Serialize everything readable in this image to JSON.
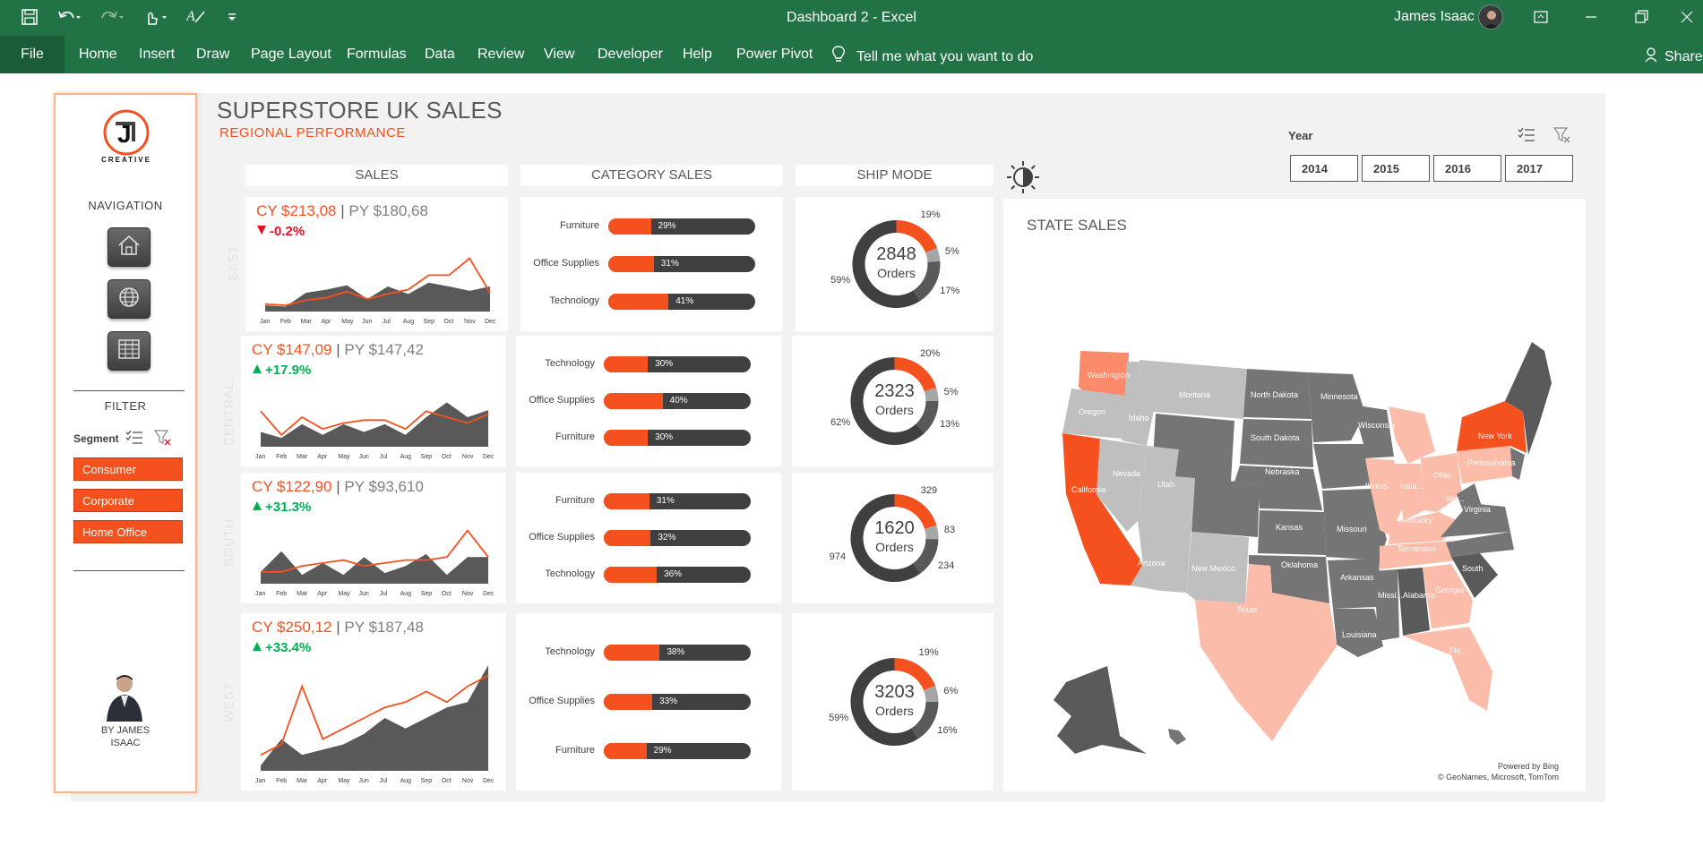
{
  "window": {
    "title": "Dashboard 2  -  Excel",
    "user": "James Isaac"
  },
  "ribbon": {
    "file": "File",
    "tabs": [
      "Home",
      "Insert",
      "Draw",
      "Page Layout",
      "Formulas",
      "Data",
      "Review",
      "View",
      "Developer",
      "Help",
      "Power Pivot"
    ],
    "tell_me": "Tell me what you want to do",
    "share": "Share"
  },
  "sidebar": {
    "logo_letter": "J",
    "logo_text": "CREATIVE",
    "navigation": "NAVIGATION",
    "nav_icons": [
      "home-icon",
      "globe-icon",
      "table-icon"
    ],
    "filter": "FILTER",
    "segment_label": "Segment",
    "segments": [
      "Consumer",
      "Corporate",
      "Home Office"
    ],
    "author": "BY JAMES ISAAC"
  },
  "header": {
    "title": "SUPERSTORE UK SALES",
    "subtitle": "REGIONAL PERFORMANCE"
  },
  "columns": {
    "sales": "SALES",
    "category": "CATEGORY SALES",
    "ship": "SHIP MODE"
  },
  "year_slicer": {
    "label": "Year",
    "years": [
      "2014",
      "2015",
      "2016",
      "2017"
    ]
  },
  "map": {
    "title": "STATE SALES",
    "credit1": "Powered by Bing",
    "credit2": "© GeoNames, Microsoft, TomTom",
    "colors": {
      "high": "#f4511e",
      "mid_high": "#fbbcaa",
      "mid": "#bfbfbf",
      "low": "#757575",
      "lowest": "#5a5a5a"
    }
  },
  "colors": {
    "accent": "#f4511e",
    "dark": "#404040",
    "up": "#00b050",
    "down": "#e81123"
  },
  "chart_data": [
    {
      "type": "area",
      "region": "EAST",
      "cy": "CY $213,08",
      "py": "PY $180,68",
      "delta": "-0.2%",
      "direction": "down",
      "categories": [
        "Jan",
        "Feb",
        "Mar",
        "Apr",
        "May",
        "Jun",
        "Jul",
        "Aug",
        "Sep",
        "Oct",
        "Nov",
        "Dec"
      ],
      "series": [
        {
          "values": [
            10,
            8,
            30,
            35,
            42,
            20,
            40,
            28,
            46,
            40,
            33,
            40
          ]
        },
        {
          "values": [
            12,
            10,
            18,
            22,
            32,
            20,
            28,
            35,
            58,
            58,
            85,
            30
          ]
        }
      ]
    },
    {
      "type": "area",
      "region": "CENTRAL",
      "cy": "CY $147,09",
      "py": "PY $147,42",
      "delta": "+17.9%",
      "direction": "up",
      "categories": [
        "Jan",
        "Feb",
        "Mar",
        "Apr",
        "May",
        "Jun",
        "Jul",
        "Aug",
        "Sep",
        "Oct",
        "Nov",
        "Dec"
      ],
      "series": [
        {
          "values": [
            25,
            15,
            38,
            20,
            38,
            25,
            38,
            20,
            50,
            75,
            50,
            62
          ]
        },
        {
          "values": [
            60,
            20,
            50,
            30,
            40,
            45,
            45,
            30,
            60,
            50,
            40,
            55
          ]
        }
      ]
    },
    {
      "type": "area",
      "region": "SOUTH",
      "cy": "CY $122,90",
      "py": "PY $93,610",
      "delta": "+31.3%",
      "direction": "up",
      "categories": [
        "Jan",
        "Feb",
        "Mar",
        "Apr",
        "May",
        "Jun",
        "Jul",
        "Aug",
        "Sep",
        "Oct",
        "Nov",
        "Dec"
      ],
      "series": [
        {
          "values": [
            20,
            55,
            15,
            35,
            15,
            45,
            18,
            30,
            50,
            15,
            45,
            45
          ]
        },
        {
          "values": [
            20,
            20,
            30,
            35,
            40,
            30,
            35,
            40,
            40,
            45,
            90,
            45
          ]
        }
      ]
    },
    {
      "type": "area",
      "region": "WEST",
      "cy": "CY $250,12",
      "py": "PY $187,48",
      "delta": "+33.4%",
      "direction": "up",
      "categories": [
        "Jan",
        "Feb",
        "Mar",
        "Apr",
        "May",
        "Jun",
        "Jul",
        "Aug",
        "Sep",
        "Oct",
        "Nov",
        "Dec"
      ],
      "series": [
        {
          "values": [
            5,
            30,
            15,
            20,
            25,
            35,
            50,
            40,
            50,
            60,
            65,
            100
          ]
        },
        {
          "values": [
            15,
            25,
            80,
            30,
            40,
            50,
            60,
            65,
            75,
            65,
            80,
            90
          ]
        }
      ]
    },
    {
      "type": "bar",
      "region": "EAST",
      "categories": [
        "Furniture",
        "Office Supplies",
        "Technology"
      ],
      "values": [
        29,
        31,
        41
      ],
      "labels": [
        "29%",
        "31%",
        "41%"
      ]
    },
    {
      "type": "bar",
      "region": "CENTRAL",
      "categories": [
        "Technology",
        "Office Supplies",
        "Furniture"
      ],
      "values": [
        30,
        40,
        30
      ],
      "labels": [
        "30%",
        "40%",
        "30%"
      ]
    },
    {
      "type": "bar",
      "region": "SOUTH",
      "categories": [
        "Furniture",
        "Office Supplies",
        "Technology"
      ],
      "values": [
        31,
        32,
        36
      ],
      "labels": [
        "31%",
        "32%",
        "36%"
      ]
    },
    {
      "type": "bar",
      "region": "WEST",
      "categories": [
        "Technology",
        "Office Supplies",
        "Furniture"
      ],
      "values": [
        38,
        33,
        29
      ],
      "labels": [
        "38%",
        "33%",
        "29%"
      ]
    },
    {
      "type": "pie",
      "region": "EAST",
      "total": "2848",
      "total_label": "Orders",
      "values": [
        19,
        5,
        17,
        59
      ],
      "labels": [
        "19%",
        "5%",
        "17%",
        "59%"
      ]
    },
    {
      "type": "pie",
      "region": "CENTRAL",
      "total": "2323",
      "total_label": "Orders",
      "values": [
        20,
        5,
        13,
        62
      ],
      "labels": [
        "20%",
        "5%",
        "13%",
        "62%"
      ]
    },
    {
      "type": "pie",
      "region": "SOUTH",
      "total": "1620",
      "total_label": "Orders",
      "values": [
        329,
        83,
        234,
        974
      ],
      "labels": [
        "329",
        "83",
        "234",
        "974"
      ]
    },
    {
      "type": "pie",
      "region": "WEST",
      "total": "3203",
      "total_label": "Orders",
      "values": [
        19,
        6,
        16,
        59
      ],
      "labels": [
        "19%",
        "6%",
        "16%",
        "59%"
      ]
    }
  ],
  "states": [
    "Washington",
    "Oregon",
    "Idaho",
    "Montana",
    "North Dakota",
    "Minnesota",
    "South Dakota",
    "Wisconsin",
    "Nevada",
    "California",
    "Utah",
    "Nebraska",
    "Illinois",
    "India...",
    "Ohio",
    "Pennsylvania",
    "New York",
    "Kansas",
    "Missouri",
    "Kentucky",
    "Virginia",
    "We...",
    "Arizona",
    "New Mexico",
    "Oklahoma",
    "Tennessee",
    "Arkansas",
    "Texas",
    "Missi...",
    "Alabama",
    "Georgia",
    "South",
    "Louisiana",
    "Flo..."
  ]
}
